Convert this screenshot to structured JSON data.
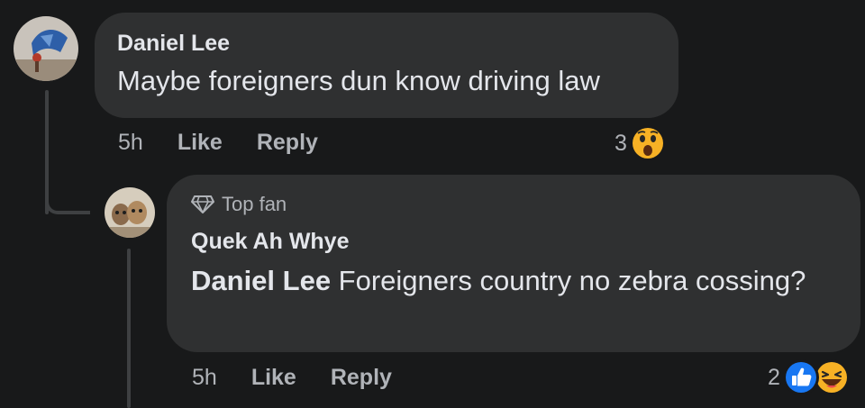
{
  "comments": [
    {
      "author": "Daniel Lee",
      "text": "Maybe foreigners dun know driving law",
      "time": "5h",
      "like_label": "Like",
      "reply_label": "Reply",
      "reaction_count": "3",
      "reactions": [
        "wow-icon"
      ]
    }
  ],
  "reply": {
    "badge": "Top fan",
    "author": "Quek Ah Whye",
    "mention": "Daniel Lee",
    "text": " Foreigners country no zebra cossing?",
    "time": "5h",
    "like_label": "Like",
    "reply_label": "Reply",
    "reaction_count": "2",
    "reactions": [
      "like-icon",
      "haha-icon"
    ]
  },
  "colors": {
    "background": "#18191a",
    "bubble": "#2f3031",
    "text": "#e4e6eb",
    "secondary": "#b0b3b8",
    "like_blue": "#1877f2",
    "emoji_yellow": "#f7b125"
  }
}
